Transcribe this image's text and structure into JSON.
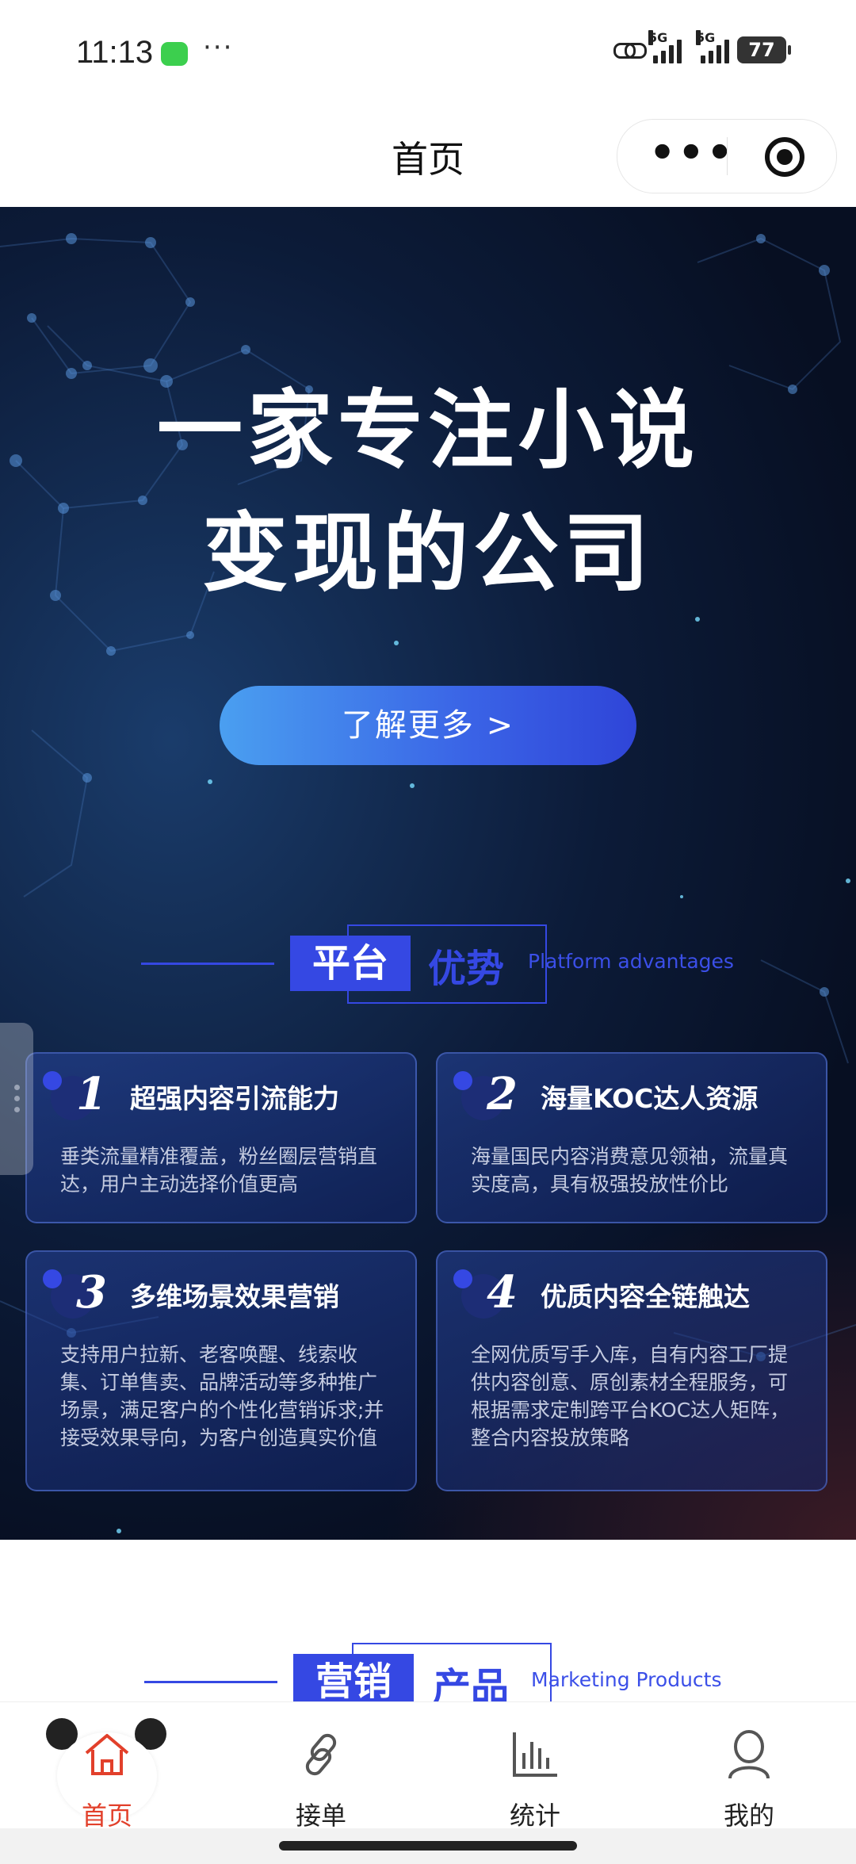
{
  "status_bar": {
    "time": "11:13",
    "dots": "···",
    "signal1_label": "5G",
    "signal2_label": "5G",
    "battery": "77"
  },
  "nav": {
    "title": "首页",
    "more_label": "•••"
  },
  "hero": {
    "headline_line1": "一家专注小说",
    "headline_line2": "变现的公司",
    "cta_label": "了解更多 >"
  },
  "platform_section": {
    "title_part1": "平台",
    "title_part2": "优势",
    "title_en": "Platform advantages"
  },
  "cards": [
    {
      "num": "1",
      "title": "超强内容引流能力",
      "desc": "垂类流量精准覆盖，粉丝圈层营销直达，用户主动选择价值更高"
    },
    {
      "num": "2",
      "title": "海量KOC达人资源",
      "desc": "海量国民内容消费意见领袖，流量真实度高，具有极强投放性价比"
    },
    {
      "num": "3",
      "title": "多维场景效果营销",
      "desc": "支持用户拉新、老客唤醒、线索收集、订单售卖、品牌活动等多种推广场景，满足客户的个性化营销诉求;并接受效果导向，为客户创造真实价值"
    },
    {
      "num": "4",
      "title": "优质内容全链触达",
      "desc": "全网优质写手入库，自有内容工厂提供内容创意、原创素材全程服务，可根据需求定制跨平台KOC达人矩阵，整合内容投放策略"
    }
  ],
  "marketing_section": {
    "title_part1": "营销",
    "title_part2": "产品",
    "title_en": "Marketing Products"
  },
  "tabbar": [
    {
      "label": "首页",
      "icon": "home-icon",
      "active": true
    },
    {
      "label": "接单",
      "icon": "link-icon",
      "active": false
    },
    {
      "label": "统计",
      "icon": "bar-chart-icon",
      "active": false
    },
    {
      "label": "我的",
      "icon": "user-icon",
      "active": false
    }
  ],
  "colors": {
    "accent_blue": "#3548e3",
    "active_tab": "#e2402b"
  }
}
